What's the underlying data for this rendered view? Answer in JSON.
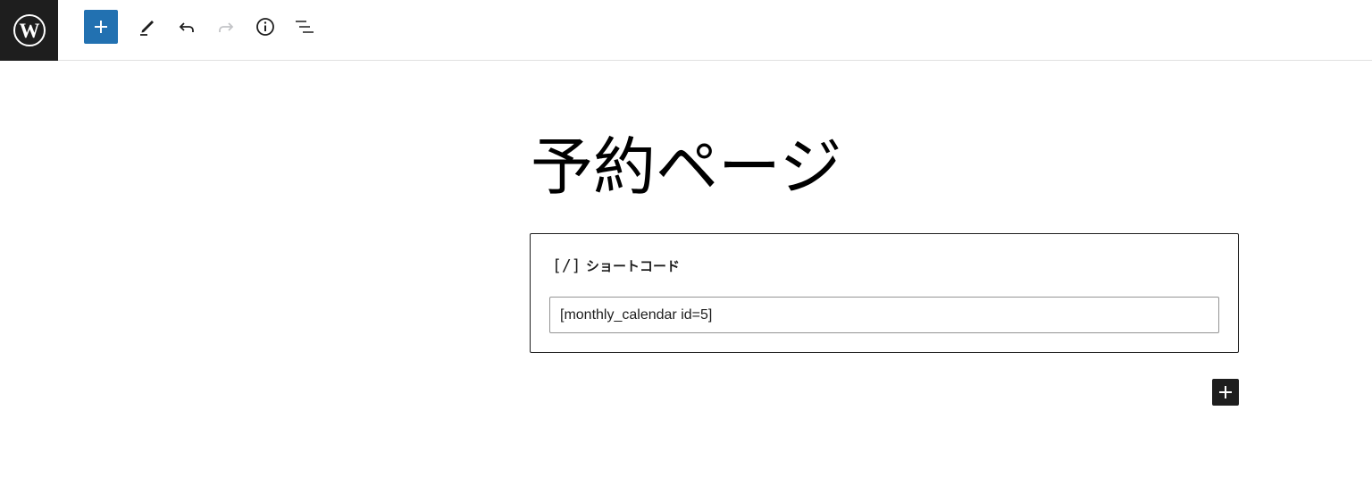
{
  "toolbar": {
    "logo_icon": "wordpress-logo-icon",
    "inserter_icon": "plus-icon",
    "tools_icon": "pencil-icon",
    "undo_icon": "undo-icon",
    "redo_icon": "redo-icon",
    "details_icon": "info-icon",
    "list_view_icon": "list-view-icon",
    "colors": {
      "inserter_bg": "#2271b1",
      "logo_bg": "#1e1e1e",
      "redo_disabled": "#c3c4c7"
    }
  },
  "post": {
    "title": "予約ページ"
  },
  "shortcode_block": {
    "icon_text": "[/]",
    "label": "ショートコード",
    "value": "[monthly_calendar id=5]"
  },
  "appender": {
    "icon": "plus-icon"
  }
}
